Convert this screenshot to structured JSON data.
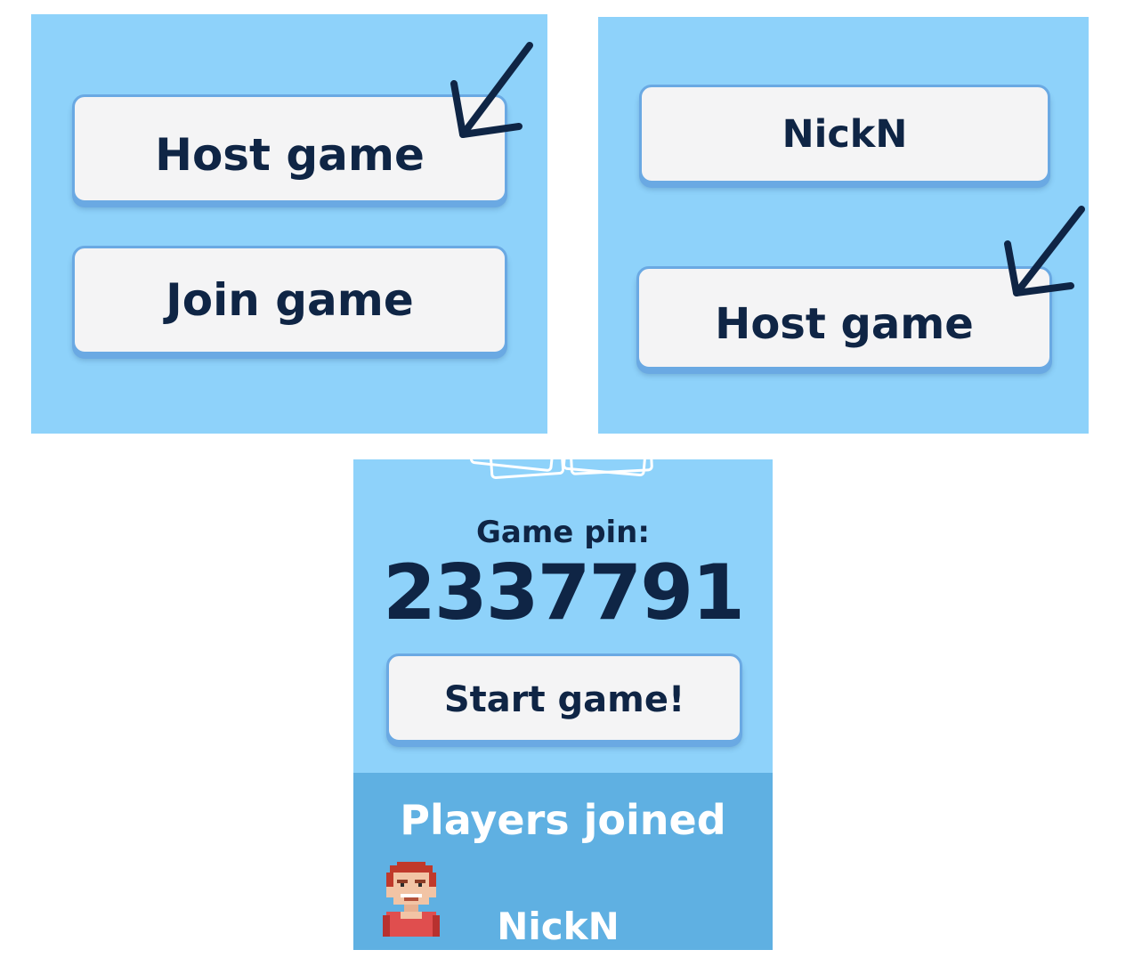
{
  "panel_1": {
    "host_label": "Host game",
    "join_label": "Join game",
    "arrow_icon": "arrow-down-left-icon"
  },
  "panel_2": {
    "name_value": "NickN",
    "host_label": "Host game",
    "arrow_icon": "arrow-down-left-icon"
  },
  "panel_3": {
    "pin_label": "Game pin:",
    "pin_value": "2337791",
    "start_label": "Start game!",
    "players_title": "Players joined",
    "players": [
      {
        "name": "NickN",
        "avatar": "pixel-character-avatar"
      }
    ]
  },
  "colors": {
    "panel_background": "#8ed2fa",
    "players_background": "#5fb0e2",
    "button_background": "#f4f4f5",
    "button_border": "#6aa9e3",
    "text_dark": "#0f2545",
    "text_light": "#ffffff"
  }
}
